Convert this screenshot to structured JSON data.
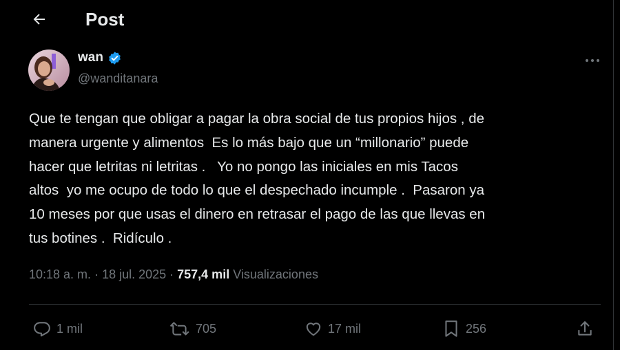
{
  "header": {
    "title": "Post"
  },
  "author": {
    "name": "wan",
    "handle": "@wanditanara"
  },
  "tweet": {
    "text": "Que te tengan que obligar a pagar la obra social de tus propios hijos , de\nmanera urgente y alimentos  Es lo más bajo que un “millonario” puede\nhacer que letritas ni letritas .   Yo no pongo las iniciales en mis Tacos\naltos  yo me ocupo de todo lo que el despechado incumple .  Pasaron ya\n10 meses por que usas el dinero en retrasar el pago de las que llevas en\ntus botines .  Ridículo ."
  },
  "meta": {
    "time": "10:18 a. m.",
    "date": "18 jul. 2025",
    "views_count": "757,4 mil",
    "views_label": "Visualizaciones"
  },
  "actions": {
    "replies": "1 mil",
    "reposts": "705",
    "likes": "17 mil",
    "bookmarks": "256"
  },
  "colors": {
    "background": "#000000",
    "text": "#e7e9ea",
    "secondary": "#71767b",
    "verified": "#1d9bf0",
    "divider": "#2f3336"
  }
}
